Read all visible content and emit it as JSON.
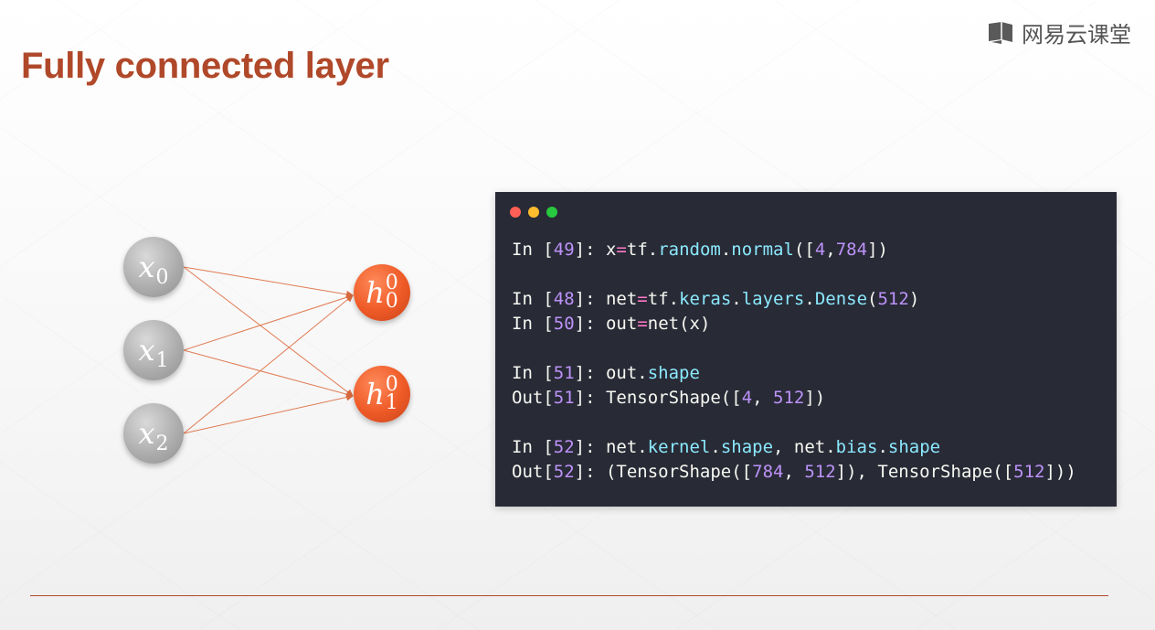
{
  "slide": {
    "title": "Fully connected layer",
    "brand": "网易云课堂",
    "brand_icon": "book-icon",
    "accent_color": "#b0482a"
  },
  "network": {
    "inputs": [
      {
        "var": "x",
        "sub": "0"
      },
      {
        "var": "x",
        "sub": "1"
      },
      {
        "var": "x",
        "sub": "2"
      }
    ],
    "outputs": [
      {
        "var": "h",
        "sup": "0",
        "sub": "0"
      },
      {
        "var": "h",
        "sup": "0",
        "sub": "1"
      }
    ],
    "input_color": "#a8a8a8",
    "output_color": "#ee5a27"
  },
  "terminal": {
    "window_dots": [
      "#ff5f56",
      "#ffbd2e",
      "#27c93f"
    ],
    "lines": [
      [
        {
          "t": "In [",
          "c": "fg"
        },
        {
          "t": "49",
          "c": "num"
        },
        {
          "t": "]: x",
          "c": "fg"
        },
        {
          "t": "=",
          "c": "op"
        },
        {
          "t": "tf.",
          "c": "fg"
        },
        {
          "t": "random",
          "c": "attr"
        },
        {
          "t": ".",
          "c": "fg"
        },
        {
          "t": "normal",
          "c": "attr"
        },
        {
          "t": "([",
          "c": "fg"
        },
        {
          "t": "4",
          "c": "num"
        },
        {
          "t": ",",
          "c": "fg"
        },
        {
          "t": "784",
          "c": "num"
        },
        {
          "t": "])",
          "c": "fg"
        }
      ],
      [],
      [
        {
          "t": "In [",
          "c": "fg"
        },
        {
          "t": "48",
          "c": "num"
        },
        {
          "t": "]: net",
          "c": "fg"
        },
        {
          "t": "=",
          "c": "op"
        },
        {
          "t": "tf.",
          "c": "fg"
        },
        {
          "t": "keras",
          "c": "attr"
        },
        {
          "t": ".",
          "c": "fg"
        },
        {
          "t": "layers",
          "c": "attr"
        },
        {
          "t": ".",
          "c": "fg"
        },
        {
          "t": "Dense",
          "c": "attr"
        },
        {
          "t": "(",
          "c": "fg"
        },
        {
          "t": "512",
          "c": "num"
        },
        {
          "t": ")",
          "c": "fg"
        }
      ],
      [
        {
          "t": "In [",
          "c": "fg"
        },
        {
          "t": "50",
          "c": "num"
        },
        {
          "t": "]: out",
          "c": "fg"
        },
        {
          "t": "=",
          "c": "op"
        },
        {
          "t": "net(x)",
          "c": "fg"
        }
      ],
      [],
      [
        {
          "t": "In [",
          "c": "fg"
        },
        {
          "t": "51",
          "c": "num"
        },
        {
          "t": "]: out.",
          "c": "fg"
        },
        {
          "t": "shape",
          "c": "attr"
        }
      ],
      [
        {
          "t": "Out[",
          "c": "fg"
        },
        {
          "t": "51",
          "c": "num"
        },
        {
          "t": "]: TensorShape([",
          "c": "fg"
        },
        {
          "t": "4",
          "c": "num"
        },
        {
          "t": ", ",
          "c": "fg"
        },
        {
          "t": "512",
          "c": "num"
        },
        {
          "t": "])",
          "c": "fg"
        }
      ],
      [],
      [
        {
          "t": "In [",
          "c": "fg"
        },
        {
          "t": "52",
          "c": "num"
        },
        {
          "t": "]: net.",
          "c": "fg"
        },
        {
          "t": "kernel",
          "c": "attr"
        },
        {
          "t": ".",
          "c": "fg"
        },
        {
          "t": "shape",
          "c": "attr"
        },
        {
          "t": ", net.",
          "c": "fg"
        },
        {
          "t": "bias",
          "c": "attr"
        },
        {
          "t": ".",
          "c": "fg"
        },
        {
          "t": "shape",
          "c": "attr"
        }
      ],
      [
        {
          "t": "Out[",
          "c": "fg"
        },
        {
          "t": "52",
          "c": "num"
        },
        {
          "t": "]: (TensorShape([",
          "c": "fg"
        },
        {
          "t": "784",
          "c": "num"
        },
        {
          "t": ", ",
          "c": "fg"
        },
        {
          "t": "512",
          "c": "num"
        },
        {
          "t": "]), TensorShape([",
          "c": "fg"
        },
        {
          "t": "512",
          "c": "num"
        },
        {
          "t": "]))",
          "c": "fg"
        }
      ]
    ],
    "colors": {
      "bg": "#282a36",
      "fg": "#f8f8f2",
      "num": "#bd93f9",
      "attr": "#8be9fd",
      "op": "#ff79c6"
    }
  }
}
